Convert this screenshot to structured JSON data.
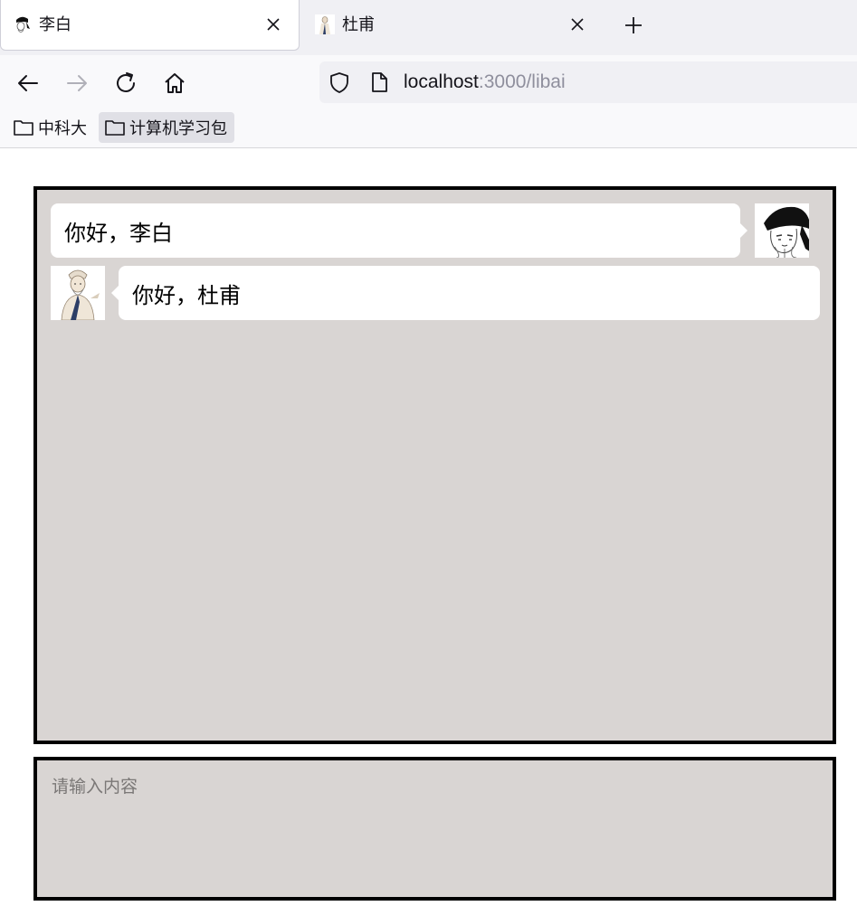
{
  "browser": {
    "tabs": [
      {
        "title": "李白",
        "active": true
      },
      {
        "title": "杜甫",
        "active": false
      }
    ],
    "url": {
      "host": "localhost",
      "rest": ":3000/libai"
    },
    "bookmarks": [
      {
        "label": "中科大"
      },
      {
        "label": "计算机学习包"
      }
    ],
    "icons": {
      "back": "arrow-left-icon",
      "forward": "arrow-right-icon",
      "reload": "reload-icon",
      "home": "home-icon",
      "shield": "shield-icon",
      "page": "page-icon",
      "folder": "folder-icon",
      "close": "close-icon",
      "new_tab": "plus-icon"
    }
  },
  "chat": {
    "messages": [
      {
        "text": "你好，李白",
        "side": "right",
        "avatar": "libai-avatar"
      },
      {
        "text": "你好，杜甫",
        "side": "left",
        "avatar": "dufu-avatar"
      }
    ],
    "input": {
      "placeholder": "请输入内容",
      "value": ""
    }
  },
  "colors": {
    "chat_bg": "#d9d5d3",
    "bubble": "#ffffff",
    "border": "#000000"
  }
}
